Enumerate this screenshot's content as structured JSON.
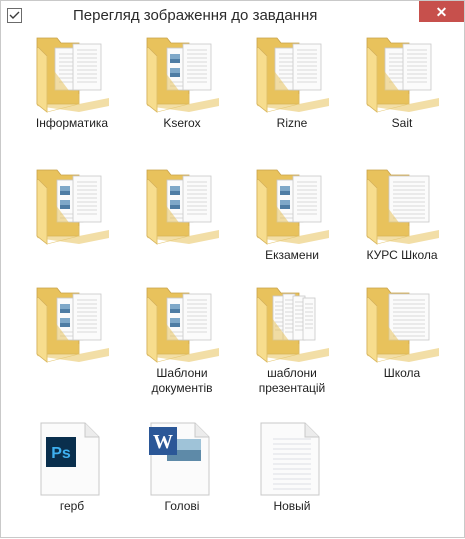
{
  "window": {
    "title": "Перегляд зображення до завдання",
    "close_label": "✕"
  },
  "items": [
    {
      "label": "Інформатика",
      "type": "folder",
      "variant": "docs"
    },
    {
      "label": "Kserox",
      "type": "folder",
      "variant": "images"
    },
    {
      "label": "Rizne",
      "type": "folder",
      "variant": "docs"
    },
    {
      "label": "Sait",
      "type": "folder",
      "variant": "docs"
    },
    {
      "label": "",
      "type": "folder",
      "variant": "images"
    },
    {
      "label": "",
      "type": "folder",
      "variant": "images"
    },
    {
      "label": "Екзамени",
      "type": "folder",
      "variant": "images"
    },
    {
      "label": "КУРС Школа",
      "type": "folder",
      "variant": "text"
    },
    {
      "label": "",
      "type": "folder",
      "variant": "images"
    },
    {
      "label": "Шаблони документів",
      "type": "folder",
      "variant": "images"
    },
    {
      "label": "шаблони презентацій",
      "type": "folder",
      "variant": "presentation"
    },
    {
      "label": "Школа",
      "type": "folder",
      "variant": "text"
    },
    {
      "label": "герб",
      "type": "file",
      "icon": "photoshop-file-icon",
      "badge": "Ps"
    },
    {
      "label": "Голові",
      "type": "file",
      "icon": "word-document-icon",
      "badge": "W"
    },
    {
      "label": "Новый",
      "type": "file",
      "icon": "text-file-icon"
    }
  ],
  "colors": {
    "folder_back": "#e8c25c",
    "folder_front": "#f7dd8e",
    "close": "#c7504c",
    "ps": "#0a2f4d",
    "ps_text": "#3fb0f0",
    "word": "#2b5797"
  }
}
